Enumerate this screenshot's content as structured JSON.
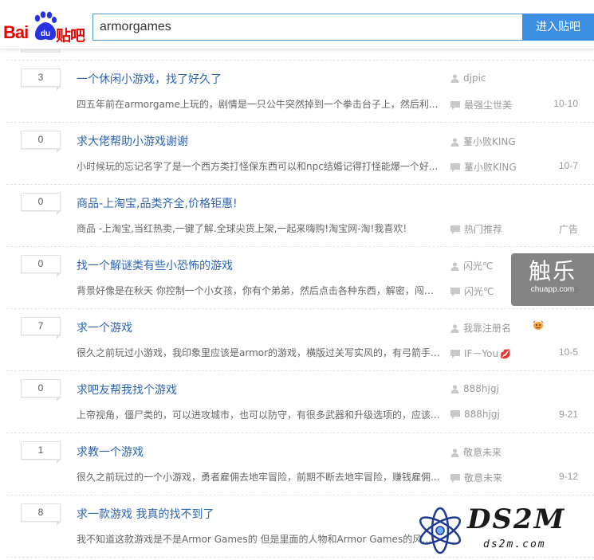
{
  "header": {
    "logo_text_bai": "Bai",
    "logo_text_du": "du",
    "logo_text_tieba": "贴吧",
    "search_value": "armorgames",
    "search_button_label": "进入贴吧"
  },
  "threads": [
    {
      "replies": "3",
      "title": "一个休闲小游戏，找了好久了",
      "abstract": "四五年前在armorgame上玩的，剧情是一只公牛突然掉到一个拳击台子上，然后利...",
      "author": "djpic",
      "last_reply": "最强尘世美",
      "time": "10-10"
    },
    {
      "replies": "0",
      "title": "求大佬帮助小游戏谢谢",
      "abstract": "小时候玩的忘记名字了是一个西方类打怪保东西可以和npc结婚记得打怪能爆一个好...",
      "author": "蓳小败KING",
      "last_reply": "蓳小败KING",
      "time": "10-7"
    },
    {
      "replies": "0",
      "title": "商品-上淘宝,品类齐全,价格钜惠!",
      "abstract": "商品 -上淘宝,当红热卖,一键了解.全球尖货上架,一起来嗨购!淘宝网-淘!我喜欢!",
      "author": "",
      "last_reply": "热门推荐",
      "time": "广告"
    },
    {
      "replies": "0",
      "title": "找一个解谜类有些小恐怖的游戏",
      "abstract": "背景好像是在秋天 你控制一个小女孩，你有个弟弟，然后点击各种东西，解密，闯关...",
      "author": "闪光℃",
      "last_reply": "闪光℃",
      "time": "10-6"
    },
    {
      "replies": "7",
      "title": "求一个游戏",
      "abstract": "很久之前玩过小游戏，我印象里应该是armor的游戏，横版过关写实风的，有弓箭手...",
      "author": "我靠注册名",
      "last_reply": "IF－You",
      "time": "10-5"
    },
    {
      "replies": "0",
      "title": "求吧友帮我找个游戏",
      "abstract": "上帝视角，僵尸类的，可以进攻城市，也可以防守，有很多武器和升级选项的，应该...",
      "author": "888hjgj",
      "last_reply": "888hjgj",
      "time": "9-21"
    },
    {
      "replies": "1",
      "title": "求教一个游戏",
      "abstract": "很久之前玩过的一个小游戏，勇者雇佣去地牢冒险，前期不断去地牢冒险，赚钱雇佣...",
      "author": "敬意未来",
      "last_reply": "敬意未来",
      "time": "9-12"
    },
    {
      "replies": "8",
      "title": "求一款游戏 我真的找不到了",
      "abstract": "我不知道这款游戏是不是Armor Games的 但是里面的人物和Armor Games的风格...",
      "author": "",
      "last_reply": "",
      "time": ""
    }
  ],
  "watermarks": {
    "chuapp_big": "触乐",
    "chuapp_small": "chuapp.com",
    "ds2m_name": "DS2M",
    "ds2m_domain": "ds2m.com"
  },
  "colors": {
    "brand_red": "#e10601",
    "brand_blue": "#2932e1",
    "link_blue": "#2d64b3",
    "button_blue": "#3d8fe4"
  }
}
